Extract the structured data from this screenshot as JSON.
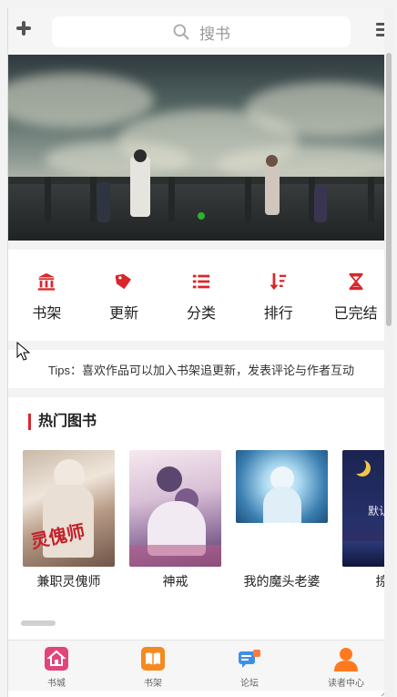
{
  "search": {
    "placeholder": "搜书"
  },
  "categories": [
    {
      "label": "书架",
      "icon": "bank-icon"
    },
    {
      "label": "更新",
      "icon": "tag-icon"
    },
    {
      "label": "分类",
      "icon": "list-icon"
    },
    {
      "label": "排行",
      "icon": "sort-icon"
    },
    {
      "label": "已完结",
      "icon": "hourglass-icon"
    }
  ],
  "tips": "Tips：喜欢作品可以加入书架追更新，发表评论与作者互动",
  "hot": {
    "title": "热门图书",
    "books": [
      {
        "title": "兼职灵傀师"
      },
      {
        "title": "神戒"
      },
      {
        "title": "我的魔头老婆"
      },
      {
        "title": "掠夺"
      }
    ],
    "cover4_text": "默认图"
  },
  "tabs": [
    {
      "label": "书城",
      "icon": "home-icon"
    },
    {
      "label": "书架",
      "icon": "book-icon"
    },
    {
      "label": "论坛",
      "icon": "forum-icon"
    },
    {
      "label": "读者中心",
      "icon": "user-icon"
    }
  ],
  "colors": {
    "accent": "#d9262b",
    "dot": "#2db22d"
  }
}
